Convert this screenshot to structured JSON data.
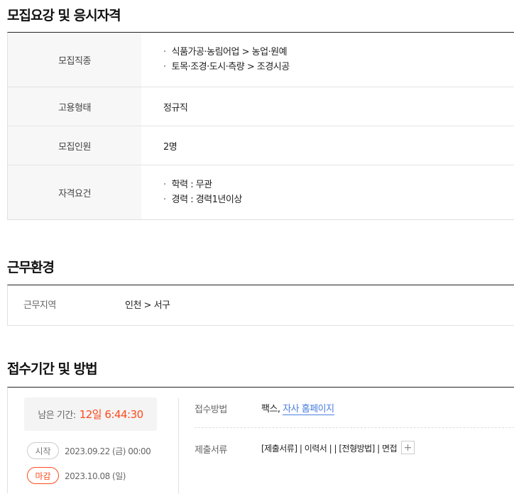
{
  "sections": {
    "requirements": {
      "title": "모집요강 및 응시자격",
      "rows": [
        {
          "label": "모집직종",
          "items": [
            "식품가공·농림어업 > 농업·원예",
            "토목·조경·도시·측량 > 조경시공"
          ]
        },
        {
          "label": "고용형태",
          "value": "정규직"
        },
        {
          "label": "모집인원",
          "value": "2명"
        },
        {
          "label": "자격요건",
          "items": [
            "학력 : 무관",
            "경력 : 경력1년이상"
          ]
        }
      ]
    },
    "environment": {
      "title": "근무환경",
      "location_label": "근무지역",
      "location_value": "인천 > 서구"
    },
    "application": {
      "title": "접수기간 및 방법",
      "remaining_label": "남은 기간:",
      "remaining_value": "12일 6:44:30",
      "start_badge": "시작",
      "start_date": "2023.09.22 (금) 00:00",
      "end_badge": "마감",
      "end_date": "2023.10.08 (일)",
      "method_label": "접수방법",
      "method_text": "팩스,",
      "method_link": "자사 홈페이지",
      "docs_label": "제출서류",
      "docs_value": "[제출서류] | 이력서 | | [전형방법] | 면접",
      "more_button": "+"
    }
  },
  "colors": {
    "accent": "#ff4a1c",
    "link": "#4a7ee0"
  }
}
